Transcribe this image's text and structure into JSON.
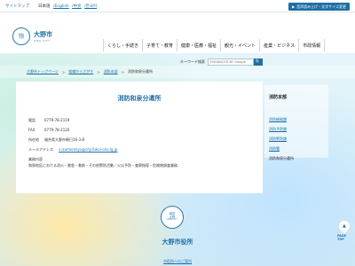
{
  "topbar": {
    "sitemap": "サイトマップ",
    "lang_label": "日本語",
    "lang_links": [
      "/English",
      "/中文",
      "/한국어"
    ],
    "access_button": "音声読み上げ・文字サイズ変更"
  },
  "header": {
    "logo_line1": "大野市",
    "logo_line2": "ONO CITY",
    "emblem_line1": "越前",
    "emblem_line2": "大野",
    "nav": [
      "くらし・手続き",
      "子育て・教育",
      "健康・医療・福祉",
      "観光・イベント",
      "産業・ビジネス",
      "市政情報"
    ]
  },
  "search": {
    "label": "キーワード検索",
    "placeholder": "ENHANCED BY Google",
    "go": "🔍"
  },
  "breadcrumb": [
    "大野市トップページ",
    "組織からさがす",
    "消防本部",
    "消防和泉分遣所"
  ],
  "main": {
    "title": "消防和泉分遣所",
    "tel_k": "電話",
    "tel_v": "0779-78-2119",
    "fax_k": "FAX",
    "fax_v": "0779-78-2120",
    "addr_k": "所在地",
    "addr_v": "福井県大野市朝日16-3-8",
    "mail_k": "メールアドレス",
    "mail_v": "s.izumiensyo@city.fukui-ono.lg.jp",
    "duty_k": "業務内容",
    "duty_v": "和泉地区における消火・救急・救助・その他警防活動／火災予防・查察指導・危険物調査業務"
  },
  "side": {
    "head": "消防本部",
    "items": [
      "消防総務課",
      "消防予防課",
      "消防警防課",
      "消防署",
      "消防和泉分遣所"
    ]
  },
  "footer": {
    "emblem_line1": "越前",
    "emblem_line2": "大野",
    "emblem_line3": "ONO CITY",
    "title": "大野市役所",
    "link": "市役所へのご案内"
  },
  "pagetop": {
    "label": "PAGE TOP",
    "arrow": "▲"
  }
}
